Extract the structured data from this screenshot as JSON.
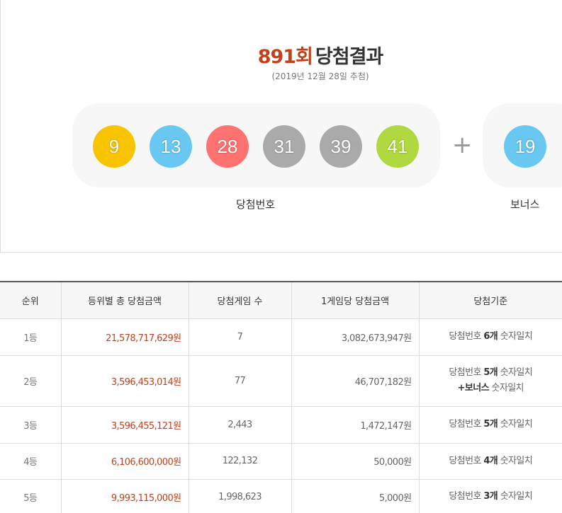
{
  "draw": {
    "round": "891회",
    "title_suffix": "당첨결과",
    "date": "(2019년 12월 28일 추첨)"
  },
  "winning_numbers": [
    {
      "number": "9",
      "color": "#f8c400"
    },
    {
      "number": "13",
      "color": "#69c8f2"
    },
    {
      "number": "28",
      "color": "#ff7272"
    },
    {
      "number": "31",
      "color": "#aaaaaa"
    },
    {
      "number": "39",
      "color": "#aaaaaa"
    },
    {
      "number": "41",
      "color": "#b0d840"
    }
  ],
  "plus_symbol": "+",
  "bonus": {
    "number": "19",
    "color": "#69c8f2"
  },
  "captions": {
    "winning": "당첨번호",
    "bonus": "보너스"
  },
  "table": {
    "headers": [
      "순위",
      "등위별 총 당첨금액",
      "당첨게임 수",
      "1게임당 당첨금액",
      "당첨기준"
    ],
    "rows": [
      {
        "rank": "1등",
        "total": "21,578,717,629원",
        "count": "7",
        "per_game": "3,082,673,947원",
        "crit_pre": "당첨번호 ",
        "crit_bold": "6개",
        "crit_post": " 숫자일치",
        "crit2_bold": "",
        "crit2_post": ""
      },
      {
        "rank": "2등",
        "total": "3,596,453,014원",
        "count": "77",
        "per_game": "46,707,182원",
        "crit_pre": "당첨번호 ",
        "crit_bold": "5개",
        "crit_post": " 숫자일치",
        "crit2_bold": "+보너스",
        "crit2_post": " 숫자일치"
      },
      {
        "rank": "3등",
        "total": "3,596,455,121원",
        "count": "2,443",
        "per_game": "1,472,147원",
        "crit_pre": "당첨번호 ",
        "crit_bold": "5개",
        "crit_post": " 숫자일치",
        "crit2_bold": "",
        "crit2_post": ""
      },
      {
        "rank": "4등",
        "total": "6,106,600,000원",
        "count": "122,132",
        "per_game": "50,000원",
        "crit_pre": "당첨번호 ",
        "crit_bold": "4개",
        "crit_post": " 숫자일치",
        "crit2_bold": "",
        "crit2_post": ""
      },
      {
        "rank": "5등",
        "total": "9,993,115,000원",
        "count": "1,998,623",
        "per_game": "5,000원",
        "crit_pre": "당첨번호 ",
        "crit_bold": "3개",
        "crit_post": " 숫자일치",
        "crit2_bold": "",
        "crit2_post": ""
      }
    ]
  }
}
